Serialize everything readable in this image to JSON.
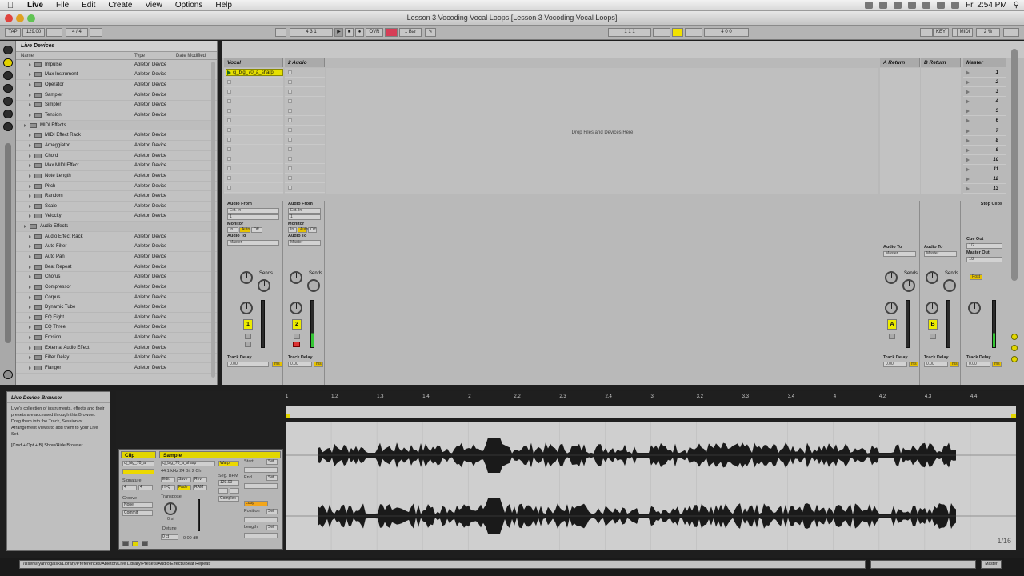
{
  "menubar": {
    "apple": "",
    "app": "Live",
    "items": [
      "File",
      "Edit",
      "Create",
      "View",
      "Options",
      "Help"
    ],
    "clock": "Fri 2:54 PM"
  },
  "window": {
    "title": "Lesson 3 Vocoding Vocal Loops  [Lesson 3 Vocoding Vocal Loops]"
  },
  "toolbar": {
    "tap": "TAP",
    "tempo": "129.00",
    "sig": "4 / 4",
    "position": "4     3     1",
    "ovr": "OVR",
    "quant": "1 Bar",
    "loop_start": "1     1     1",
    "loop_len": "4     0     0",
    "key": "KEY",
    "midi": "MIDI",
    "cpu": "2 %"
  },
  "browser": {
    "title": "Live Devices",
    "columns": [
      "Name",
      "Type",
      "Date Modified"
    ],
    "rows": [
      {
        "name": "Impulse",
        "type": "Ableton Device",
        "cat": false
      },
      {
        "name": "Max Instrument",
        "type": "Ableton Device",
        "cat": false
      },
      {
        "name": "Operator",
        "type": "Ableton Device",
        "cat": false
      },
      {
        "name": "Sampler",
        "type": "Ableton Device",
        "cat": false
      },
      {
        "name": "Simpler",
        "type": "Ableton Device",
        "cat": false
      },
      {
        "name": "Tension",
        "type": "Ableton Device",
        "cat": false
      },
      {
        "name": "MIDI Effects",
        "type": "",
        "cat": true
      },
      {
        "name": "MIDI Effect Rack",
        "type": "Ableton Device",
        "cat": false
      },
      {
        "name": "Arpeggiator",
        "type": "Ableton Device",
        "cat": false
      },
      {
        "name": "Chord",
        "type": "Ableton Device",
        "cat": false
      },
      {
        "name": "Max MIDI Effect",
        "type": "Ableton Device",
        "cat": false
      },
      {
        "name": "Note Length",
        "type": "Ableton Device",
        "cat": false
      },
      {
        "name": "Pitch",
        "type": "Ableton Device",
        "cat": false
      },
      {
        "name": "Random",
        "type": "Ableton Device",
        "cat": false
      },
      {
        "name": "Scale",
        "type": "Ableton Device",
        "cat": false
      },
      {
        "name": "Velocity",
        "type": "Ableton Device",
        "cat": false
      },
      {
        "name": "Audio Effects",
        "type": "",
        "cat": true
      },
      {
        "name": "Audio Effect Rack",
        "type": "Ableton Device",
        "cat": false
      },
      {
        "name": "Auto Filter",
        "type": "Ableton Device",
        "cat": false
      },
      {
        "name": "Auto Pan",
        "type": "Ableton Device",
        "cat": false
      },
      {
        "name": "Beat Repeat",
        "type": "Ableton Device",
        "cat": false
      },
      {
        "name": "Chorus",
        "type": "Ableton Device",
        "cat": false
      },
      {
        "name": "Compressor",
        "type": "Ableton Device",
        "cat": false
      },
      {
        "name": "Corpus",
        "type": "Ableton Device",
        "cat": false
      },
      {
        "name": "Dynamic Tube",
        "type": "Ableton Device",
        "cat": false
      },
      {
        "name": "EQ Eight",
        "type": "Ableton Device",
        "cat": false
      },
      {
        "name": "EQ Three",
        "type": "Ableton Device",
        "cat": false
      },
      {
        "name": "Erosion",
        "type": "Ableton Device",
        "cat": false
      },
      {
        "name": "External Audio Effect",
        "type": "Ableton Device",
        "cat": false
      },
      {
        "name": "Filter Delay",
        "type": "Ableton Device",
        "cat": false
      },
      {
        "name": "Flanger",
        "type": "Ableton Device",
        "cat": false
      }
    ]
  },
  "session": {
    "tracks": [
      {
        "name": "Vocal",
        "number": "1",
        "clip": "cj_big_70_a_sharp"
      },
      {
        "name": "2 Audio",
        "number": "2",
        "clip": ""
      }
    ],
    "returns": [
      {
        "name": "A Return",
        "letter": "A"
      },
      {
        "name": "B Return",
        "letter": "B"
      }
    ],
    "master": {
      "name": "Master",
      "stop_clips": "Stop Clips",
      "cue_out": "Cue Out",
      "master_out": "Master Out",
      "cue_val": "1/2",
      "out_val": "1/2"
    },
    "scenes": [
      "1",
      "2",
      "3",
      "4",
      "5",
      "6",
      "7",
      "8",
      "9",
      "10",
      "11",
      "12",
      "13"
    ],
    "drop_text": "Drop Files and Devices Here",
    "mixer": {
      "audio_from": "Audio From",
      "ext_in": "Ext. In",
      "ch": "1",
      "monitor": "Monitor",
      "mon_opts": [
        "In",
        "Auto",
        "Off"
      ],
      "audio_to": "Audio To",
      "master": "Master",
      "sends": "Sends",
      "track_delay": "Track Delay",
      "delay_val": "0.00",
      "ms": "ms",
      "post": "Post"
    }
  },
  "info": {
    "title": "Live Device Browser",
    "body": "Live's collection of instruments, effects and their presets are accessed through this Browser. Drag them into the Track, Session or Arrangement Views to add them to your Live Set.",
    "shortcut": "[Cmd + Opt + B] Show/Hide Browser"
  },
  "clip": {
    "title": "Clip",
    "name": "cj_big_70_a",
    "signature": "Signature",
    "sig_num": "4",
    "sig_den": "4",
    "groove": "Groove",
    "groove_val": "None",
    "commit": "Commit",
    "sample_title": "Sample",
    "sample_name": "cj_big_70_a_sharp",
    "sample_info": "44.1 kHz 24 Bit 2 Ch",
    "edit": "Edit",
    "save": "Save",
    "rev": "Rev",
    "hiq": "Hi-Q",
    "fade": "Fade",
    "ram": "RAM",
    "transpose": "Transpose",
    "transpose_val": "0 st",
    "detune": "Detune",
    "detune_val": "0 ct",
    "gain": "0.00 dB",
    "warp": "Warp",
    "seg_bpm": "Seg. BPM",
    "bpm": "129.00",
    "complex": "Complex",
    "start": "Start",
    "end": "End",
    "loop": "Loop",
    "position": "Position",
    "length": "Length",
    "set": "Set"
  },
  "ruler": {
    "ticks": [
      "1",
      "1.2",
      "1.3",
      "1.4",
      "2",
      "2.2",
      "2.3",
      "2.4",
      "3",
      "3.2",
      "3.3",
      "3.4",
      "4",
      "4.2",
      "4.3",
      "4.4"
    ]
  },
  "waveform": {
    "zoom": "1/16"
  },
  "status": {
    "path": "/Users/ryanrogalski/Library/Preferences/Ableton/Live Library/Presets/Audio Effects/Beat Repeat/",
    "cpu_label": "",
    "master_label": "Master"
  }
}
